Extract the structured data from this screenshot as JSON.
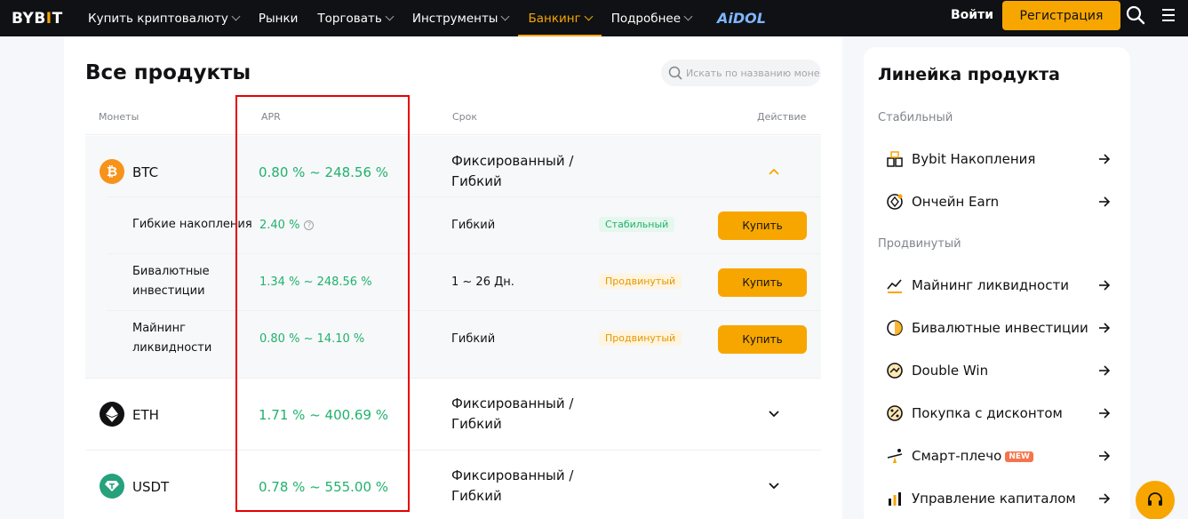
{
  "header": {
    "logo_left": "BYB",
    "logo_bar": "I",
    "logo_right": "T",
    "nav": [
      {
        "label": "Купить криптовалюту",
        "has_dropdown": true
      },
      {
        "label": "Рынки",
        "has_dropdown": false
      },
      {
        "label": "Торговать",
        "has_dropdown": true
      },
      {
        "label": "Инструменты",
        "has_dropdown": true
      },
      {
        "label": "Банкинг",
        "has_dropdown": true,
        "active": true
      },
      {
        "label": "Подробнее",
        "has_dropdown": true
      }
    ],
    "promo_logo": "AiDOL",
    "login_label": "Войти",
    "register_label": "Регистрация",
    "icons": [
      "search-icon",
      "menu-icon"
    ]
  },
  "products": {
    "title": "Все продукты",
    "search_placeholder": "Искать по названию монеты",
    "columns": {
      "coin": "Монеты",
      "apr": "APR",
      "term": "Срок",
      "action": "Действие"
    },
    "coins": [
      {
        "symbol": "BTC",
        "icon": "btc-icon",
        "color": "#f7931a",
        "apr": "0.80 % ~ 248.56 %",
        "term": "Фиксированный / Гибкий",
        "expanded": true,
        "subproducts": [
          {
            "name": "Гибкие накопления",
            "apr": "2.40 %",
            "has_info": true,
            "term": "Гибкий",
            "tag": "Стабильный",
            "tag_type": "stable",
            "action": "Купить"
          },
          {
            "name": "Бивалютные инвестиции",
            "apr": "1.34 % ~ 248.56 %",
            "term": "1 ~ 26 Дн.",
            "tag": "Продвинутый",
            "tag_type": "advanced",
            "action": "Купить"
          },
          {
            "name": "Майнинг ликвидности",
            "apr": "0.80 % ~ 14.10 %",
            "term": "Гибкий",
            "tag": "Продвинутый",
            "tag_type": "advanced",
            "action": "Купить"
          }
        ]
      },
      {
        "symbol": "ETH",
        "icon": "eth-icon",
        "color": "#121214",
        "apr": "1.71 % ~ 400.69 %",
        "term": "Фиксированный / Гибкий",
        "expanded": false
      },
      {
        "symbol": "USDT",
        "icon": "usdt-icon",
        "color": "#26a17b",
        "apr": "0.78 % ~ 555.00 %",
        "term": "Фиксированный / Гибкий",
        "expanded": false
      }
    ]
  },
  "product_line": {
    "title": "Линейка продукта",
    "sections": [
      {
        "label": "Стабильный",
        "items": [
          {
            "label": "Bybit Накопления",
            "icon": "savings-icon"
          },
          {
            "label": "Ончейн Earn",
            "icon": "onchain-earn-icon"
          }
        ]
      },
      {
        "label": "Продвинутый",
        "items": [
          {
            "label": "Майнинг ликвидности",
            "icon": "liquidity-mining-icon"
          },
          {
            "label": "Бивалютные инвестиции",
            "icon": "dual-asset-icon"
          },
          {
            "label": "Double Win",
            "icon": "double-win-icon"
          },
          {
            "label": "Покупка с дисконтом",
            "icon": "discount-buy-icon"
          },
          {
            "label": "Смарт-плечо",
            "icon": "smart-leverage-icon",
            "badge": "NEW"
          },
          {
            "label": "Управление капиталом",
            "icon": "wealth-management-icon"
          }
        ]
      }
    ]
  },
  "accent_color": "#f7a600",
  "positive_color": "#20b26c",
  "highlight_box_color": "#e60000"
}
